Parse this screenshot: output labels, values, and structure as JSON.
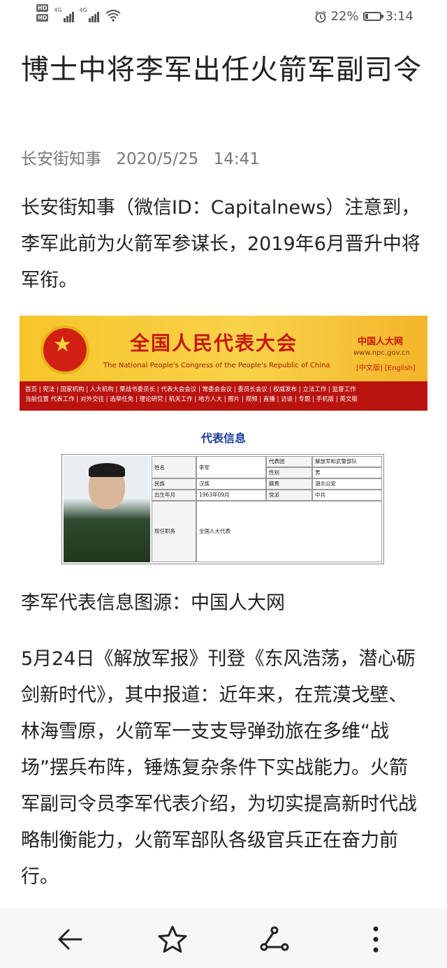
{
  "status_bar": {
    "hd1": "HD",
    "hd2": "HD",
    "net1": "4G",
    "net2": "4G",
    "battery_percent": "22%",
    "battery_level": 0.22,
    "time": "3:14"
  },
  "article": {
    "title": "博士中将李军出任火箭军副司令",
    "source": "长安街知事",
    "date": "2020/5/25",
    "time": "14:41",
    "paragraph1": "长安街知事（微信ID：Capitalnews）注意到，李军此前为火箭军参谋长，2019年6月晋升中将军衔。",
    "caption": "李军代表信息图源：中国人大网",
    "paragraph2": "5月24日《解放军报》刊登《东风浩荡，潜心砺剑新时代》，其中报道：近年来，在荒漠戈壁、林海雪原，火箭军一支支导弹劲旅在多维“战场”摆兵布阵，锤炼复杂条件下实战能力。火箭军副司令员李军代表介绍，为切实提高新时代战略制衡能力，火箭军部队各级官兵正在奋力前行。"
  },
  "npc_image": {
    "site_name": "全国人民代表大会",
    "site_name_en": "The National People's Congress of the People's Republic of China",
    "logo_text": "中国人大网",
    "url": "www.npc.gov.cn",
    "lang": "[中文版]  [English]",
    "nav_line1": "首页 | 宪法 | 国家机构 | 人大机构 | 栗战书委员长 | 代表大会会议 | 常委会会议 | 委员长会议 | 权威发布 | 立法工作 | 监督工作",
    "nav_line2": "当前位置 代表工作 | 对外交往 | 选举任免 | 理论研究 | 机关工作 | 地方人大 | 图片 | 视频 | 直播 | 访谈 | 专题 | 手机版 | 英文版",
    "section_title": "代表信息",
    "fields": {
      "name_label": "姓名",
      "name": "李军",
      "delegation_label": "代表团",
      "delegation": "解放军和武警部队",
      "gender_label": "性别",
      "gender": "男",
      "ethnicity_label": "民族",
      "ethnicity": "汉族",
      "origin_label": "籍贯",
      "origin": "湖北公安",
      "birth_label": "出生年月",
      "birth": "1963年09月",
      "party_label": "党派",
      "party": "中共",
      "position_label": "现任职务",
      "position": "全国人大代表"
    }
  },
  "bottom_nav": {
    "back": "back-arrow-icon",
    "favorite": "star-icon",
    "share": "share-icon",
    "more": "more-icon"
  }
}
